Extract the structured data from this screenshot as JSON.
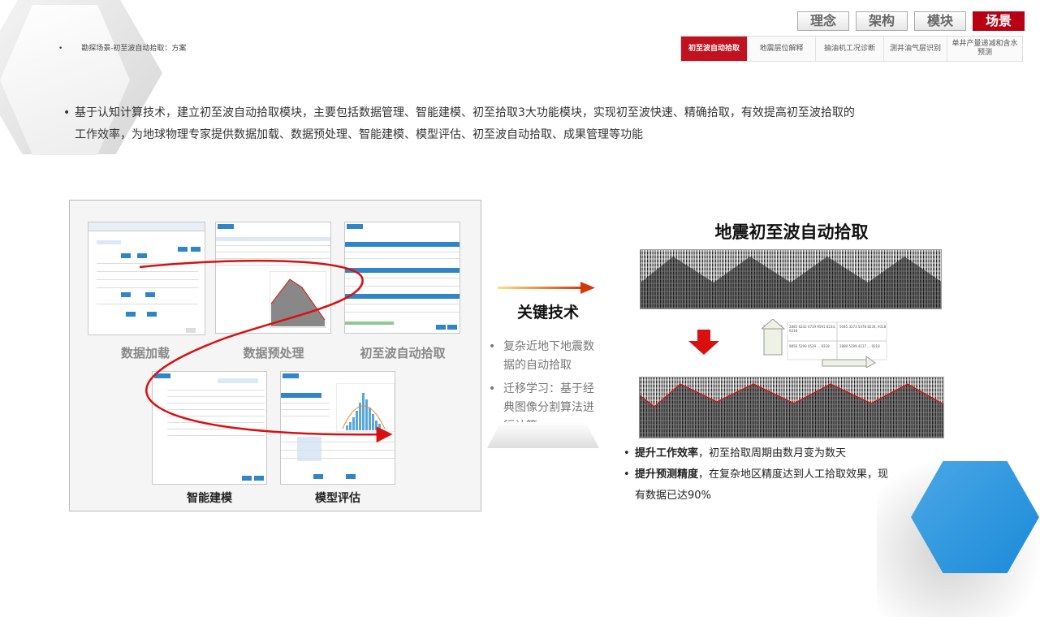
{
  "breadcrumb": "勘探场景-初至波自动拾取：方案",
  "tabs_top": [
    "理念",
    "架构",
    "模块",
    "场景"
  ],
  "active_top_tab": "场景",
  "subtabs": [
    "初至波自动拾取",
    "地震层位解释",
    "抽油机工况诊断",
    "测井油气层识别",
    "单井产量递减和含水预测"
  ],
  "active_subtab": "初至波自动拾取",
  "intro": {
    "line1": "基于认知计算技术，建立初至波自动拾取模块，主要包括数据管理、智能建模、初至拾取3大功能模块，实现初至波快速、精确拾取，有效提高初至波拾取的",
    "line2": "工作效率，为地球物理专家提供数据加载、数据预处理、智能建模、模型评估、初至波自动拾取、成果管理等功能"
  },
  "workflow": {
    "step1": "数据加载",
    "step2": "数据预处理",
    "step3": "初至波自动拾取",
    "step4": "智能建模",
    "step5": "模型评估"
  },
  "key_tech": {
    "title": "关键技术",
    "item1": "复杂近地下地震数据的自动拾取",
    "item2": "迁移学习：基于经典图像分割算法进行计算"
  },
  "right": {
    "title": "地震初至波自动拾取",
    "cell1": "2885 6242 4719 9591 8234, 9318",
    "cell2": "5045 3273 5478 8234, 9318",
    "cell3": "9856 5299 4529 ... 9318",
    "cell4": "2880 5299 4127 ... 9318"
  },
  "results": {
    "r1_bold": "提升工作效率",
    "r1_text": "，初至拾取周期由数月变为数天",
    "r2_bold": "提升预测精度",
    "r2_text": "，在复杂地区精度达到人工拾取效果，现",
    "r2_text2": "有数据已达90%"
  },
  "colors": {
    "accent_red": "#b80014",
    "curve_red": "#d81010",
    "ui_blue": "#2e86c9",
    "hex_blue": "#1b8ad8"
  }
}
